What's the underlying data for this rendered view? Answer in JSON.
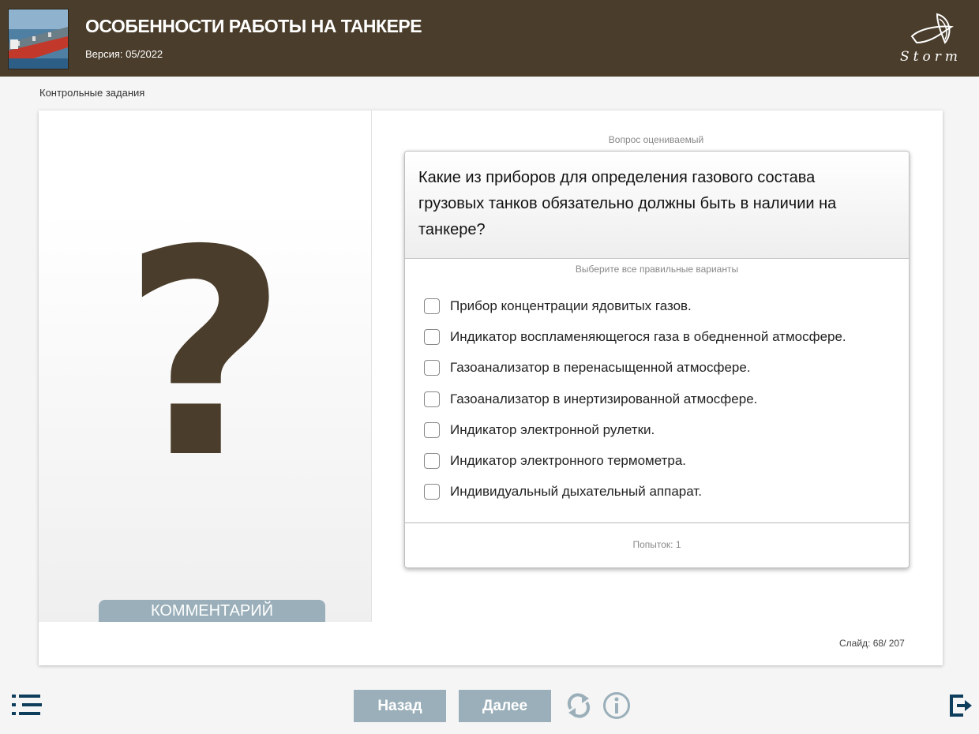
{
  "header": {
    "title": "ОСОБЕННОСТИ РАБОТЫ НА ТАНКЕРЕ",
    "version": "Версия: 05/2022",
    "thumbnail_icon": "tanker-ship-thumbnail",
    "logo_text": "Storm",
    "background_color": "#4a3d2b"
  },
  "section": {
    "label": "Контрольные задания"
  },
  "left_panel": {
    "symbol": "?",
    "comment_button": "КОММЕНТАРИЙ"
  },
  "question": {
    "caption": "Вопрос оцениваемый",
    "text": "Какие из приборов для определения газового состава грузовых танков обязательно должны быть в наличии на танкере?",
    "hint": "Выберите все правильные варианты",
    "options": [
      {
        "label": "Прибор концентрации ядовитых газов.",
        "checked": false
      },
      {
        "label": "Индикатор воспламеняющегося газа в обедненной атмосфере.",
        "checked": false
      },
      {
        "label": "Газоанализатор в перенасыщенной атмосфере.",
        "checked": false
      },
      {
        "label": "Газоанализатор в инертизированной атмосфере.",
        "checked": false
      },
      {
        "label": "Индикатор электронной рулетки.",
        "checked": false
      },
      {
        "label": "Индикатор электронного термометра.",
        "checked": false
      },
      {
        "label": "Индивидуальный дыхательный аппарат.",
        "checked": false
      }
    ],
    "attempts": "Попыток: 1"
  },
  "slide": {
    "counter": "Слайд:  68/ 207"
  },
  "toolbar": {
    "back_label": "Назад",
    "next_label": "Далее",
    "menu_icon": "list-menu-icon",
    "reload_icon": "refresh-icon",
    "info_icon": "info-icon",
    "exit_icon": "exit-icon",
    "button_color": "#9aafb9"
  }
}
